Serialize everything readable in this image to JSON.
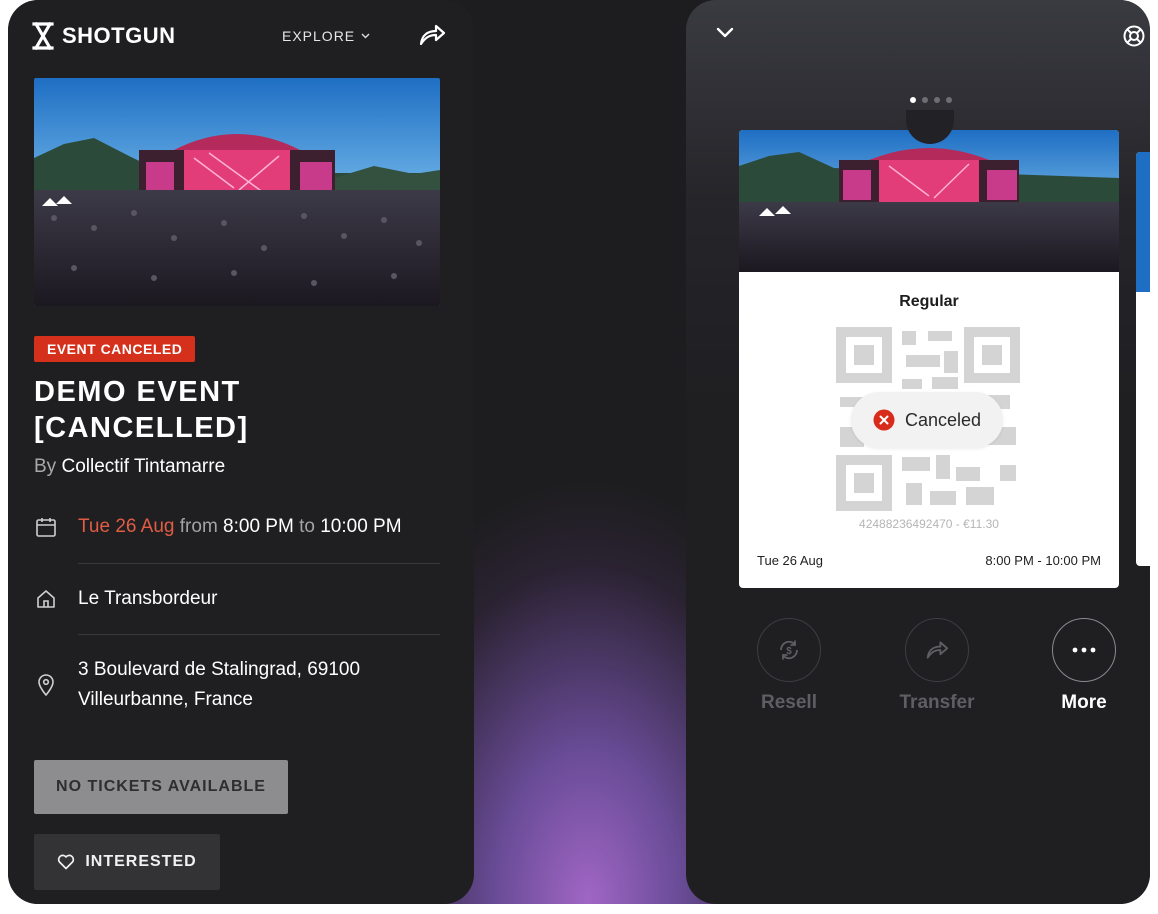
{
  "left": {
    "brand": "SHOTGUN",
    "nav_explore": "EXPLORE",
    "badge": "EVENT CANCELED",
    "title_line1": "DEMO EVENT",
    "title_line2": "[CANCELLED]",
    "by_prefix": "By",
    "organizer": "Collectif Tintamarre",
    "date": "Tue 26 Aug",
    "from_word": "from",
    "start_time": "8:00 PM",
    "to_word": "to",
    "end_time": "10:00 PM",
    "venue": "Le Transbordeur",
    "address_line1": "3 Boulevard de Stalingrad, 69100",
    "address_line2": "Villeurbanne, France",
    "no_tickets_label": "NO TICKETS AVAILABLE",
    "interested_label": "INTERESTED"
  },
  "right": {
    "carousel_total": 4,
    "carousel_active": 1,
    "ticket_type": "Regular",
    "status": "Canceled",
    "ticket_code": "42488236492470 - €11.30",
    "ticket_date": "Tue 26 Aug",
    "ticket_time": "8:00 PM - 10:00 PM",
    "actions": {
      "resell": "Resell",
      "transfer": "Transfer",
      "more": "More"
    }
  },
  "colors": {
    "accent_red": "#d5301c",
    "date_red": "#e15c44",
    "background": "#1f1f21"
  }
}
